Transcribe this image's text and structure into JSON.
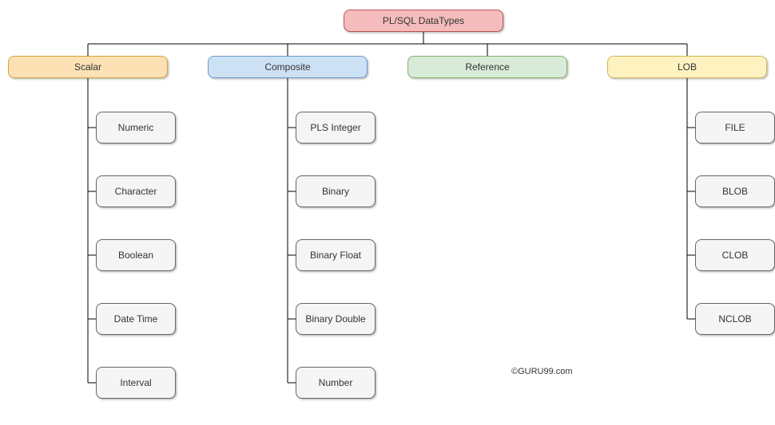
{
  "root": {
    "label": "PL/SQL DataTypes",
    "fill": "#f4bcbc",
    "stroke": "#b85450"
  },
  "categories": [
    {
      "key": "scalar",
      "label": "Scalar",
      "fill": "#fce1b4",
      "stroke": "#d6a33a"
    },
    {
      "key": "composite",
      "label": "Composite",
      "fill": "#cde1f5",
      "stroke": "#6a9bd1"
    },
    {
      "key": "reference",
      "label": "Reference",
      "fill": "#d8ebd8",
      "stroke": "#82b366"
    },
    {
      "key": "lob",
      "label": "LOB",
      "fill": "#fef2c0",
      "stroke": "#d6b656"
    }
  ],
  "children": {
    "scalar": [
      "Numeric",
      "Character",
      "Boolean",
      "Date Time",
      "Interval"
    ],
    "composite": [
      "PLS Integer",
      "Binary",
      "Binary Float",
      "Binary Double",
      "Number"
    ],
    "reference": [],
    "lob": [
      "FILE",
      "BLOB",
      "CLOB",
      "NCLOB"
    ]
  },
  "leafColors": {
    "fill": "#f5f5f5",
    "stroke": "#666666"
  },
  "watermark": "©GURU99.com"
}
